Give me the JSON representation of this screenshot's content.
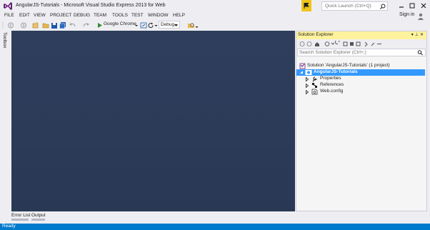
{
  "window": {
    "title": "AngularJS-Tutorials - Microsoft Visual Studio Express 2013 for Web"
  },
  "quick_launch": {
    "placeholder": "Quick Launch (Ctrl+Q)"
  },
  "account": {
    "sign_in": "Sign in"
  },
  "menu": {
    "items": [
      "FILE",
      "EDIT",
      "VIEW",
      "PROJECT",
      "DEBUG",
      "TEAM",
      "TOOLS",
      "TEST",
      "WINDOW",
      "HELP"
    ]
  },
  "toolbar": {
    "start_target": "Google Chrome",
    "configuration": "Debug"
  },
  "toolbox": {
    "label": "Toolbox"
  },
  "bottom_tabs": [
    "Error List",
    "Output"
  ],
  "solution_explorer": {
    "title": "Solution Explorer",
    "search_placeholder": "Search Solution Explorer (Ctrl+;)",
    "solution_label": "Solution 'AngularJS-Tutorials' (1 project)",
    "project_label": "AngularJS-Tutorials",
    "items": [
      "Properties",
      "References",
      "Web.config"
    ]
  },
  "status": {
    "text": "Ready"
  },
  "colors": {
    "status_bar": "#007acc",
    "editor_background": "#2b3b59",
    "selection": "#3399ff",
    "active_header": "#fff29d",
    "notification": "#f0c419"
  }
}
